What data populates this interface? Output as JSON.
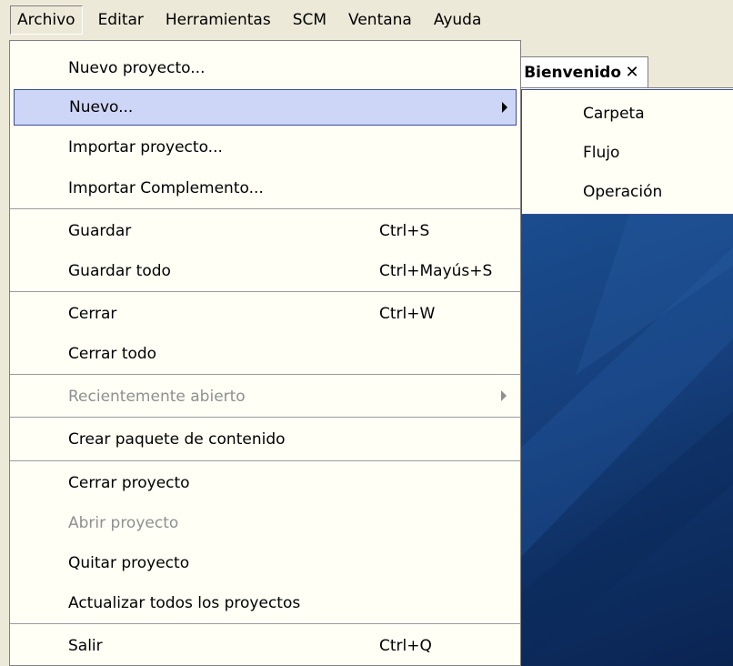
{
  "menubar": {
    "items": [
      {
        "label": "Archivo"
      },
      {
        "label": "Editar"
      },
      {
        "label": "Herramientas"
      },
      {
        "label": "SCM"
      },
      {
        "label": "Ventana"
      },
      {
        "label": "Ayuda"
      }
    ]
  },
  "editor": {
    "tab_label": "Bienvenido",
    "tab_close": "✕"
  },
  "file_menu": {
    "items": [
      {
        "label": "Nuevo proyecto...",
        "shortcut": ""
      },
      {
        "label": "Nuevo...",
        "shortcut": "",
        "submenu": true,
        "highlighted": true
      },
      {
        "label": "Importar proyecto...",
        "shortcut": ""
      },
      {
        "label": "Importar Complemento...",
        "shortcut": ""
      },
      {
        "label": "Guardar",
        "shortcut": "Ctrl+S"
      },
      {
        "label": "Guardar todo",
        "shortcut": "Ctrl+Mayús+S"
      },
      {
        "label": "Cerrar",
        "shortcut": "Ctrl+W"
      },
      {
        "label": "Cerrar todo",
        "shortcut": ""
      },
      {
        "label": "Recientemente abierto",
        "shortcut": "",
        "submenu": true,
        "disabled": true
      },
      {
        "label": "Crear paquete de contenido",
        "shortcut": ""
      },
      {
        "label": "Cerrar proyecto",
        "shortcut": ""
      },
      {
        "label": "Abrir proyecto",
        "shortcut": "",
        "disabled": true
      },
      {
        "label": "Quitar proyecto",
        "shortcut": ""
      },
      {
        "label": "Actualizar todos los proyectos",
        "shortcut": ""
      },
      {
        "label": "Salir",
        "shortcut": "Ctrl+Q"
      }
    ]
  },
  "new_submenu": {
    "items": [
      {
        "label": "Carpeta"
      },
      {
        "label": "Flujo"
      },
      {
        "label": "Operación"
      }
    ]
  },
  "colors": {
    "menu_background": "#fffff6",
    "highlight": "#cdd6f6",
    "highlight_border": "#3a4d99",
    "disabled_text": "#8f8f8f",
    "chrome": "#ece9d8",
    "welcome_blue": "#1a4d8f"
  },
  "icons": {
    "submenu_arrow": "triangle-right-icon",
    "tab_close": "close-icon"
  }
}
